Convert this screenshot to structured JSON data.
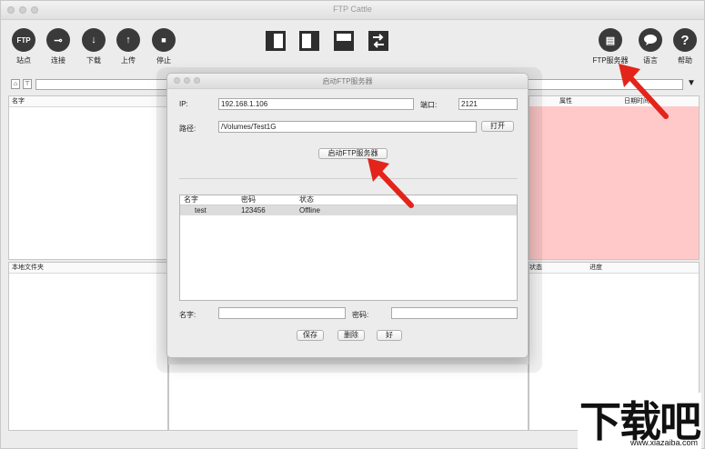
{
  "app": {
    "title": "FTP Cattle"
  },
  "toolbar": {
    "left": [
      {
        "label": "站点",
        "icon": "ftp-site-icon",
        "glyph": "FTP"
      },
      {
        "label": "连接",
        "icon": "key-icon",
        "glyph": "⊸"
      },
      {
        "label": "下载",
        "icon": "arrow-down-icon",
        "glyph": "↓"
      },
      {
        "label": "上传",
        "icon": "arrow-up-icon",
        "glyph": "↑"
      },
      {
        "label": "停止",
        "icon": "stop-icon",
        "glyph": "■"
      }
    ],
    "layout_icons": [
      "layout-left-pane-icon",
      "layout-right-pane-icon",
      "layout-bottom-pane-icon",
      "swap-arrows-icon"
    ],
    "right": [
      {
        "label": "FTP服务器",
        "icon": "server-icon",
        "glyph": "▤"
      },
      {
        "label": "语言",
        "icon": "speech-bubble-icon",
        "glyph": "💬"
      },
      {
        "label": "帮助",
        "icon": "help-icon",
        "glyph": "?"
      }
    ]
  },
  "panels": {
    "top_left_header": "名字",
    "top_right_headers": [
      "属性",
      "日期时间"
    ],
    "bottom_left_header": "本地文件夹",
    "bottom_right_headers": [
      "状态",
      "进度"
    ],
    "highlight_color": "#ffc9c9"
  },
  "dialog": {
    "title": "启动FTP服务器",
    "ip_label": "IP:",
    "ip_value": "192.168.1.106",
    "port_label": "端口:",
    "port_value": "2121",
    "path_label": "路径:",
    "path_value": "/Volumes/Test1G",
    "open_button": "打开",
    "start_button": "启动FTP服务器",
    "list_headers": [
      "名字",
      "密码",
      "状态"
    ],
    "users": [
      {
        "name": "test",
        "password": "123456",
        "status": "Offline"
      }
    ],
    "name_label": "名字:",
    "password_label": "密码:",
    "save_button": "保存",
    "delete_button": "删除",
    "ok_button": "好"
  },
  "watermark": {
    "big": "下载吧",
    "small": "www.xiazaiba.com"
  },
  "colors": {
    "arrow": "#e3241b",
    "toolbar_icon": "#3a3a3a"
  }
}
